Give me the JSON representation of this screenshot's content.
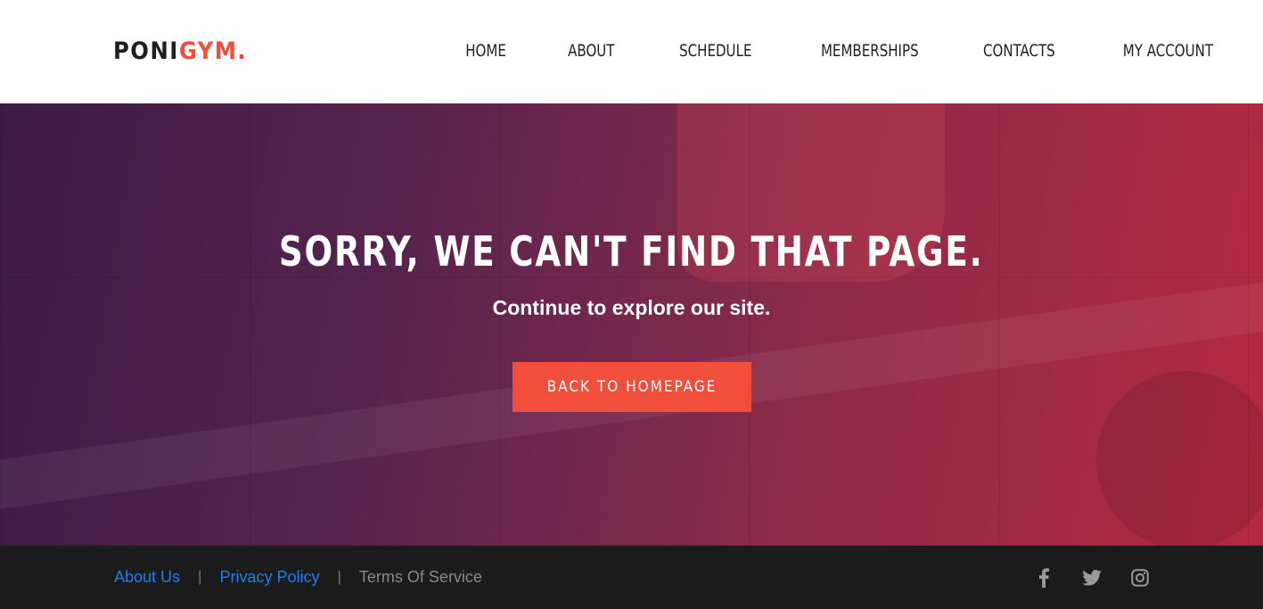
{
  "logo": {
    "part1": "PONI",
    "part2": "GYM."
  },
  "nav": {
    "items": [
      {
        "label": "HOME"
      },
      {
        "label": "ABOUT"
      },
      {
        "label": "SCHEDULE"
      },
      {
        "label": "MEMBERSHIPS"
      },
      {
        "label": "CONTACTS"
      },
      {
        "label": "MY ACCOUNT"
      }
    ]
  },
  "hero": {
    "title": "SORRY, WE CAN'T FIND THAT PAGE.",
    "subtitle": "Continue to explore our site.",
    "button_label": "BACK TO HOMEPAGE"
  },
  "footer": {
    "links": [
      {
        "label": "About Us"
      },
      {
        "label": "Privacy Policy"
      },
      {
        "label": "Terms Of Service"
      }
    ],
    "separator": "|",
    "social": [
      "facebook-icon",
      "twitter-icon",
      "instagram-icon"
    ]
  },
  "colors": {
    "accent": "#f24e3c",
    "link": "#1a7ff0",
    "muted_link": "#8a8a8a",
    "footer_bg": "#1b1b1b",
    "icon": "#9a9a9a"
  }
}
